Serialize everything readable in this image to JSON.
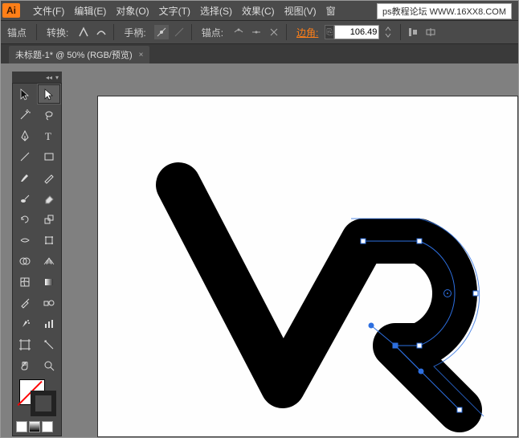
{
  "watermark": "ps教程论坛  WWW.16XX8.COM",
  "app_icon_label": "Ai",
  "menubar": {
    "items": [
      {
        "label": "文件(F)"
      },
      {
        "label": "编辑(E)"
      },
      {
        "label": "对象(O)"
      },
      {
        "label": "文字(T)"
      },
      {
        "label": "选择(S)"
      },
      {
        "label": "效果(C)"
      },
      {
        "label": "视图(V)"
      },
      {
        "label": "窗"
      }
    ]
  },
  "optionsbar": {
    "anchor_label": "锚点",
    "convert_label": "转换:",
    "handle_label": "手柄:",
    "anchor2_label": "锚点:",
    "corner_label": "边角:",
    "corner_value": "106.49",
    "link_glyph": "⎘"
  },
  "doc_tab": {
    "title": "未标题-1* @ 50% (RGB/预览)",
    "close": "×"
  },
  "toolbox_header": {
    "collapse": "◂◂",
    "menu": "▾"
  },
  "colors": {
    "accent": "#ff7f18",
    "panel": "#4a4a4a",
    "canvas": "#fefefe",
    "selection": "#2d6fe0",
    "artwork": "#000000"
  }
}
